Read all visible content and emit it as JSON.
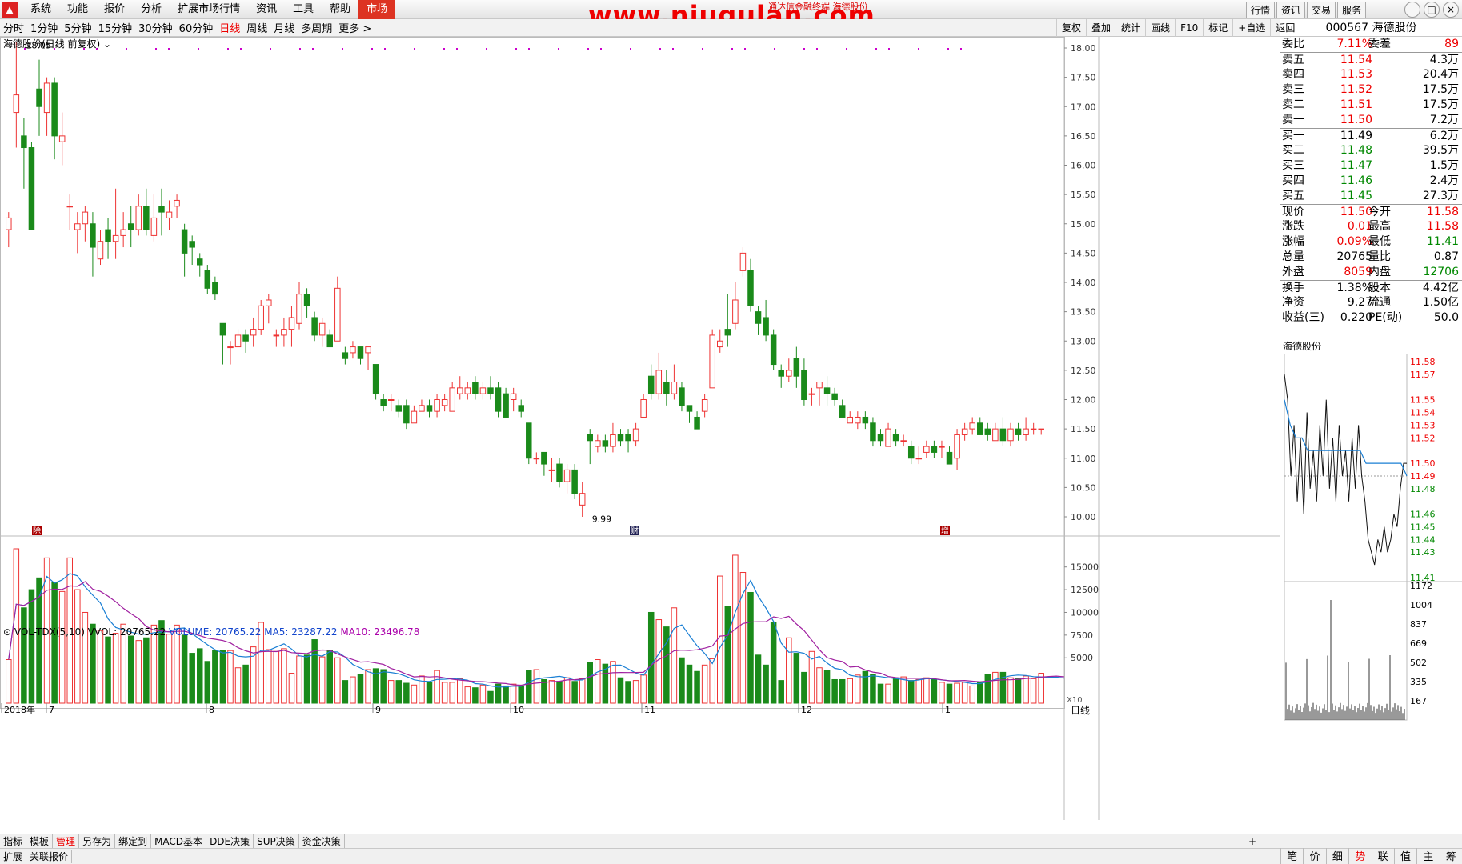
{
  "menubar": {
    "items": [
      "系统",
      "功能",
      "报价",
      "分析",
      "扩展市场行情",
      "资讯",
      "工具",
      "帮助",
      "市场"
    ],
    "active": "市场"
  },
  "watermark": "www.niugulan.com",
  "title_text": "通达信金融终端  海德股份",
  "right_buttons": [
    "行情",
    "资讯",
    "交易",
    "服务"
  ],
  "periods": {
    "items": [
      "分时",
      "1分钟",
      "5分钟",
      "15分钟",
      "30分钟",
      "60分钟",
      "日线",
      "周线",
      "月线",
      "多周期",
      "更多 >"
    ],
    "active": "日线"
  },
  "tool_buttons": [
    "复权",
    "叠加",
    "统计",
    "画线",
    "F10",
    "标记",
    "+自选",
    "返回"
  ],
  "chart_title": "海德股份(日线 前复权)",
  "vol_info": {
    "label": "VOL-TDX(5,10)",
    "vvol": "VVOL: 20765.22",
    "volume": "VOLUME: 20765.22",
    "ma5": "MA5: 23287.22",
    "ma10": "MA10: 23496.78"
  },
  "bottom_tabs": [
    "指标",
    "模板",
    "管理",
    "另存为",
    "绑定到",
    "MACD基本",
    "DDE决策",
    "SUP决策",
    "资金决策"
  ],
  "bottom_tabs_active": "管理",
  "bottom_tabs2": [
    "扩展",
    "关联报价"
  ],
  "period_label": "日线",
  "x10_label": "X10",
  "quote": {
    "code": "000567",
    "name": "海德股份",
    "wb": {
      "label": "委比",
      "value": "7.11%",
      "label2": "委差",
      "value2": "89"
    },
    "sell": [
      {
        "label": "卖五",
        "price": "11.54",
        "vol": "4.3万"
      },
      {
        "label": "卖四",
        "price": "11.53",
        "vol": "20.4万"
      },
      {
        "label": "卖三",
        "price": "11.52",
        "vol": "17.5万"
      },
      {
        "label": "卖二",
        "price": "11.51",
        "vol": "17.5万"
      },
      {
        "label": "卖一",
        "price": "11.50",
        "vol": "7.2万"
      }
    ],
    "buy": [
      {
        "label": "买一",
        "price": "11.49",
        "vol": "6.2万"
      },
      {
        "label": "买二",
        "price": "11.48",
        "vol": "39.5万"
      },
      {
        "label": "买三",
        "price": "11.47",
        "vol": "1.5万"
      },
      {
        "label": "买四",
        "price": "11.46",
        "vol": "2.4万"
      },
      {
        "label": "买五",
        "price": "11.45",
        "vol": "27.3万"
      }
    ],
    "stats": [
      {
        "l1": "现价",
        "v1": "11.50",
        "c1": "red",
        "l2": "今开",
        "v2": "11.58",
        "c2": "red"
      },
      {
        "l1": "涨跌",
        "v1": "0.01",
        "c1": "red",
        "l2": "最高",
        "v2": "11.58",
        "c2": "red"
      },
      {
        "l1": "涨幅",
        "v1": "0.09%",
        "c1": "red",
        "l2": "最低",
        "v2": "11.41",
        "c2": "green"
      },
      {
        "l1": "总量",
        "v1": "20765",
        "c1": "",
        "l2": "量比",
        "v2": "0.87",
        "c2": ""
      },
      {
        "l1": "外盘",
        "v1": "8059",
        "c1": "red",
        "l2": "内盘",
        "v2": "12706",
        "c2": "green"
      },
      {
        "l1": "换手",
        "v1": "1.38%",
        "c1": "",
        "l2": "股本",
        "v2": "4.42亿",
        "c2": ""
      },
      {
        "l1": "净资",
        "v1": "9.27",
        "c1": "",
        "l2": "流通",
        "v2": "1.50亿",
        "c2": ""
      },
      {
        "l1": "收益(三)",
        "v1": "0.220",
        "c1": "",
        "l2": "PE(动)",
        "v2": "50.0",
        "c2": ""
      }
    ]
  },
  "mini_title": "海德股份",
  "mini_tabs": [
    "笔",
    "价",
    "细",
    "势",
    "联",
    "值",
    "主",
    "筹"
  ],
  "mini_tabs_active": "势",
  "price_axis": [
    "18.00",
    "17.50",
    "17.00",
    "16.50",
    "16.00",
    "15.50",
    "15.00",
    "14.50",
    "14.00",
    "13.50",
    "13.00",
    "12.50",
    "12.00",
    "11.50",
    "11.00",
    "10.50",
    "10.00"
  ],
  "vol_axis": [
    "15000",
    "12500",
    "10000",
    "7500",
    "5000"
  ],
  "mini_price_axis": [
    "11.58",
    "11.57",
    "11.55",
    "11.54",
    "11.53",
    "11.52",
    "11.50",
    "11.49",
    "11.48",
    "11.46",
    "11.45",
    "11.44",
    "11.43",
    "11.41"
  ],
  "mini_vol_axis": [
    "1172",
    "1004",
    "837",
    "669",
    "502",
    "335",
    "167"
  ],
  "date_labels": [
    "2018年",
    "7",
    "8",
    "9",
    "10",
    "11",
    "12",
    "1"
  ],
  "annotations": {
    "high": "18.05",
    "low": "9.99",
    "markers": [
      "除",
      "财",
      "增"
    ]
  },
  "chart_data": {
    "type": "candlestick",
    "ylim": [
      10.0,
      18.0
    ],
    "candles": [
      [
        14.9,
        15.1,
        14.6,
        15.2
      ],
      [
        16.9,
        17.2,
        16.3,
        18.1
      ],
      [
        16.5,
        16.3,
        15.6,
        16.8
      ],
      [
        16.3,
        14.9,
        14.9,
        16.4
      ],
      [
        17.3,
        17.0,
        16.5,
        17.8
      ],
      [
        16.9,
        17.4,
        16.5,
        17.5
      ],
      [
        17.4,
        16.5,
        16.1,
        17.5
      ],
      [
        16.4,
        16.5,
        16.0,
        16.9
      ],
      [
        15.3,
        15.3,
        14.9,
        15.5
      ],
      [
        14.9,
        15.0,
        14.5,
        15.2
      ],
      [
        15.0,
        15.2,
        14.7,
        15.3
      ],
      [
        15.0,
        14.6,
        14.1,
        15.2
      ],
      [
        14.4,
        14.7,
        14.3,
        14.9
      ],
      [
        14.9,
        14.7,
        14.4,
        15.1
      ],
      [
        14.7,
        14.8,
        14.4,
        15.6
      ],
      [
        14.8,
        14.9,
        14.6,
        15.2
      ],
      [
        15.0,
        14.9,
        14.6,
        15.3
      ],
      [
        14.9,
        15.3,
        14.8,
        15.5
      ],
      [
        15.3,
        14.9,
        14.8,
        15.6
      ],
      [
        14.8,
        15.1,
        14.7,
        15.5
      ],
      [
        15.3,
        15.2,
        14.8,
        15.6
      ],
      [
        15.1,
        15.2,
        14.9,
        15.4
      ],
      [
        15.3,
        15.4,
        15.1,
        15.5
      ],
      [
        14.9,
        14.5,
        14.1,
        15.0
      ],
      [
        14.7,
        14.6,
        14.3,
        14.8
      ],
      [
        14.4,
        14.3,
        14.1,
        14.5
      ],
      [
        14.2,
        13.9,
        13.8,
        14.3
      ],
      [
        14.0,
        13.8,
        13.7,
        14.1
      ],
      [
        13.3,
        13.1,
        12.6,
        13.3
      ],
      [
        12.9,
        12.9,
        12.6,
        13.0
      ],
      [
        12.9,
        13.1,
        12.9,
        13.2
      ],
      [
        13.1,
        13.0,
        12.8,
        13.2
      ],
      [
        13.1,
        13.2,
        12.9,
        13.4
      ],
      [
        13.2,
        13.6,
        13.1,
        13.7
      ],
      [
        13.6,
        13.7,
        13.3,
        13.8
      ],
      [
        13.1,
        13.1,
        12.9,
        13.2
      ],
      [
        13.1,
        13.2,
        12.9,
        13.4
      ],
      [
        13.2,
        13.4,
        12.9,
        13.6
      ],
      [
        13.3,
        13.8,
        13.2,
        14.0
      ],
      [
        13.8,
        13.6,
        13.4,
        13.9
      ],
      [
        13.4,
        13.1,
        13.0,
        13.5
      ],
      [
        13.1,
        13.3,
        12.9,
        13.4
      ],
      [
        13.1,
        12.9,
        12.9,
        13.2
      ],
      [
        13.0,
        13.9,
        13.0,
        14.1
      ],
      [
        12.8,
        12.7,
        12.6,
        12.9
      ],
      [
        12.8,
        12.9,
        12.7,
        13.0
      ],
      [
        12.9,
        12.7,
        12.6,
        12.9
      ],
      [
        12.8,
        12.9,
        12.5,
        12.9
      ],
      [
        12.6,
        12.1,
        12.0,
        12.6
      ],
      [
        12.0,
        11.9,
        11.8,
        12.1
      ],
      [
        12.0,
        12.0,
        11.8,
        12.1
      ],
      [
        11.9,
        11.8,
        11.7,
        12.0
      ],
      [
        11.9,
        11.6,
        11.5,
        12.0
      ],
      [
        11.6,
        11.8,
        11.6,
        11.9
      ],
      [
        11.8,
        11.9,
        11.8,
        12.0
      ],
      [
        11.9,
        11.8,
        11.7,
        12.0
      ],
      [
        11.8,
        12.0,
        11.7,
        12.1
      ],
      [
        11.9,
        12.0,
        11.8,
        12.1
      ],
      [
        11.8,
        12.2,
        11.8,
        12.3
      ],
      [
        12.1,
        12.2,
        12.0,
        12.4
      ],
      [
        12.1,
        12.2,
        12.0,
        12.3
      ],
      [
        12.3,
        12.1,
        12.0,
        12.4
      ],
      [
        12.1,
        12.2,
        12.0,
        12.3
      ],
      [
        12.2,
        12.1,
        12.0,
        12.4
      ],
      [
        12.2,
        11.8,
        11.7,
        12.3
      ],
      [
        12.1,
        11.7,
        11.7,
        12.2
      ],
      [
        12.0,
        12.1,
        11.8,
        12.2
      ],
      [
        11.9,
        11.8,
        11.7,
        12.0
      ],
      [
        11.6,
        11.0,
        10.9,
        11.6
      ],
      [
        11.0,
        11.0,
        10.9,
        11.1
      ],
      [
        11.1,
        10.9,
        10.7,
        11.1
      ],
      [
        10.8,
        10.8,
        10.6,
        11.0
      ],
      [
        10.9,
        10.6,
        10.5,
        11.0
      ],
      [
        10.6,
        10.8,
        10.4,
        10.9
      ],
      [
        10.8,
        10.4,
        10.3,
        10.9
      ],
      [
        10.2,
        10.4,
        10.0,
        10.6
      ],
      [
        11.4,
        11.3,
        10.9,
        11.5
      ],
      [
        11.2,
        11.3,
        11.1,
        11.4
      ],
      [
        11.3,
        11.2,
        11.1,
        11.4
      ],
      [
        11.2,
        11.4,
        11.1,
        11.6
      ],
      [
        11.4,
        11.3,
        11.2,
        11.5
      ],
      [
        11.4,
        11.3,
        11.1,
        11.5
      ],
      [
        11.3,
        11.5,
        11.2,
        11.6
      ],
      [
        11.7,
        12.0,
        11.7,
        12.1
      ],
      [
        12.4,
        12.1,
        12.0,
        12.6
      ],
      [
        12.1,
        12.5,
        12.0,
        12.8
      ],
      [
        12.3,
        12.1,
        11.9,
        12.5
      ],
      [
        12.1,
        12.3,
        12.0,
        12.6
      ],
      [
        12.2,
        11.9,
        11.8,
        12.3
      ],
      [
        11.9,
        11.8,
        11.6,
        11.9
      ],
      [
        11.7,
        11.5,
        11.5,
        11.8
      ],
      [
        11.8,
        12.0,
        11.7,
        12.1
      ],
      [
        12.2,
        13.1,
        12.2,
        13.2
      ],
      [
        12.9,
        13.0,
        12.8,
        13.2
      ],
      [
        13.2,
        13.1,
        12.9,
        13.8
      ],
      [
        13.3,
        13.7,
        13.2,
        14.0
      ],
      [
        14.2,
        14.5,
        14.1,
        14.6
      ],
      [
        14.2,
        13.6,
        13.5,
        14.4
      ],
      [
        13.5,
        13.3,
        13.1,
        13.6
      ],
      [
        13.4,
        13.1,
        13.0,
        13.7
      ],
      [
        13.1,
        12.6,
        12.5,
        13.2
      ],
      [
        12.5,
        12.4,
        12.2,
        12.6
      ],
      [
        12.4,
        12.5,
        12.3,
        12.7
      ],
      [
        12.7,
        12.4,
        12.2,
        12.9
      ],
      [
        12.5,
        12.0,
        11.9,
        12.7
      ],
      [
        12.1,
        12.1,
        11.9,
        12.2
      ],
      [
        12.2,
        12.3,
        11.9,
        12.3
      ],
      [
        12.2,
        12.1,
        11.9,
        12.4
      ],
      [
        12.1,
        12.0,
        11.9,
        12.2
      ],
      [
        11.9,
        11.7,
        11.7,
        12.0
      ],
      [
        11.6,
        11.7,
        11.6,
        11.8
      ],
      [
        11.6,
        11.7,
        11.5,
        11.8
      ],
      [
        11.7,
        11.6,
        11.5,
        11.8
      ],
      [
        11.6,
        11.3,
        11.2,
        11.7
      ],
      [
        11.4,
        11.3,
        11.2,
        11.5
      ],
      [
        11.2,
        11.5,
        11.2,
        11.6
      ],
      [
        11.4,
        11.3,
        11.2,
        11.5
      ],
      [
        11.3,
        11.3,
        11.2,
        11.4
      ],
      [
        11.2,
        11.0,
        10.9,
        11.3
      ],
      [
        11.0,
        11.0,
        10.9,
        11.2
      ],
      [
        11.1,
        11.2,
        11.0,
        11.3
      ],
      [
        11.2,
        11.1,
        11.0,
        11.3
      ],
      [
        11.2,
        11.2,
        11.0,
        11.3
      ],
      [
        11.1,
        10.9,
        10.9,
        11.2
      ],
      [
        11.0,
        11.4,
        10.8,
        11.5
      ],
      [
        11.4,
        11.5,
        11.3,
        11.6
      ],
      [
        11.5,
        11.6,
        11.4,
        11.7
      ],
      [
        11.6,
        11.4,
        11.4,
        11.7
      ],
      [
        11.5,
        11.4,
        11.3,
        11.6
      ],
      [
        11.3,
        11.5,
        11.3,
        11.6
      ],
      [
        11.5,
        11.3,
        11.2,
        11.7
      ],
      [
        11.3,
        11.5,
        11.2,
        11.6
      ],
      [
        11.5,
        11.4,
        11.3,
        11.6
      ],
      [
        11.4,
        11.5,
        11.3,
        11.7
      ],
      [
        11.5,
        11.5,
        11.4,
        11.6
      ],
      [
        11.5,
        11.5,
        11.4,
        11.5
      ]
    ],
    "volumes": [
      4800,
      17000,
      10500,
      12500,
      13800,
      16000,
      13300,
      12300,
      16000,
      12500,
      10000,
      8700,
      8000,
      7300,
      7700,
      8700,
      7400,
      6900,
      7200,
      8600,
      9100,
      7600,
      8600,
      7500,
      5500,
      6000,
      4600,
      5800,
      5800,
      5800,
      3900,
      4200,
      6200,
      8900,
      5900,
      5700,
      6000,
      3300,
      5200,
      5300,
      7000,
      5100,
      5800,
      5000,
      2500,
      2900,
      3200,
      3700,
      3800,
      3700,
      2500,
      2500,
      2200,
      2000,
      3000,
      2300,
      3600,
      2300,
      2300,
      2700,
      1800,
      1700,
      2000,
      1300,
      2100,
      1900,
      2100,
      1900,
      3600,
      3700,
      2600,
      2500,
      2400,
      2800,
      2400,
      2700,
      4500,
      4800,
      4300,
      4600,
      2800,
      2400,
      2500,
      3100,
      10000,
      9200,
      8400,
      10500,
      5000,
      4200,
      3500,
      4200,
      4900,
      14000,
      10700,
      16300,
      14400,
      12200,
      5300,
      4200,
      8900,
      2500,
      7200,
      5500,
      3400,
      5700,
      3900,
      3600,
      2600,
      2600,
      2700,
      3100,
      3500,
      3200,
      2100,
      2100,
      2700,
      2900,
      2500,
      2600,
      2800,
      2600,
      2300,
      2100,
      2200,
      2300,
      1900,
      2300,
      3200,
      3400,
      3400,
      2800,
      2700,
      3000,
      2700,
      3300,
      2600,
      2800,
      2400
    ],
    "ma_lines": [
      {
        "name": "MA5",
        "values": []
      },
      {
        "name": "MA10",
        "values": []
      }
    ]
  },
  "mini_chart": {
    "type": "line",
    "ylim": [
      11.41,
      11.58
    ],
    "prev_close": 11.49
  }
}
